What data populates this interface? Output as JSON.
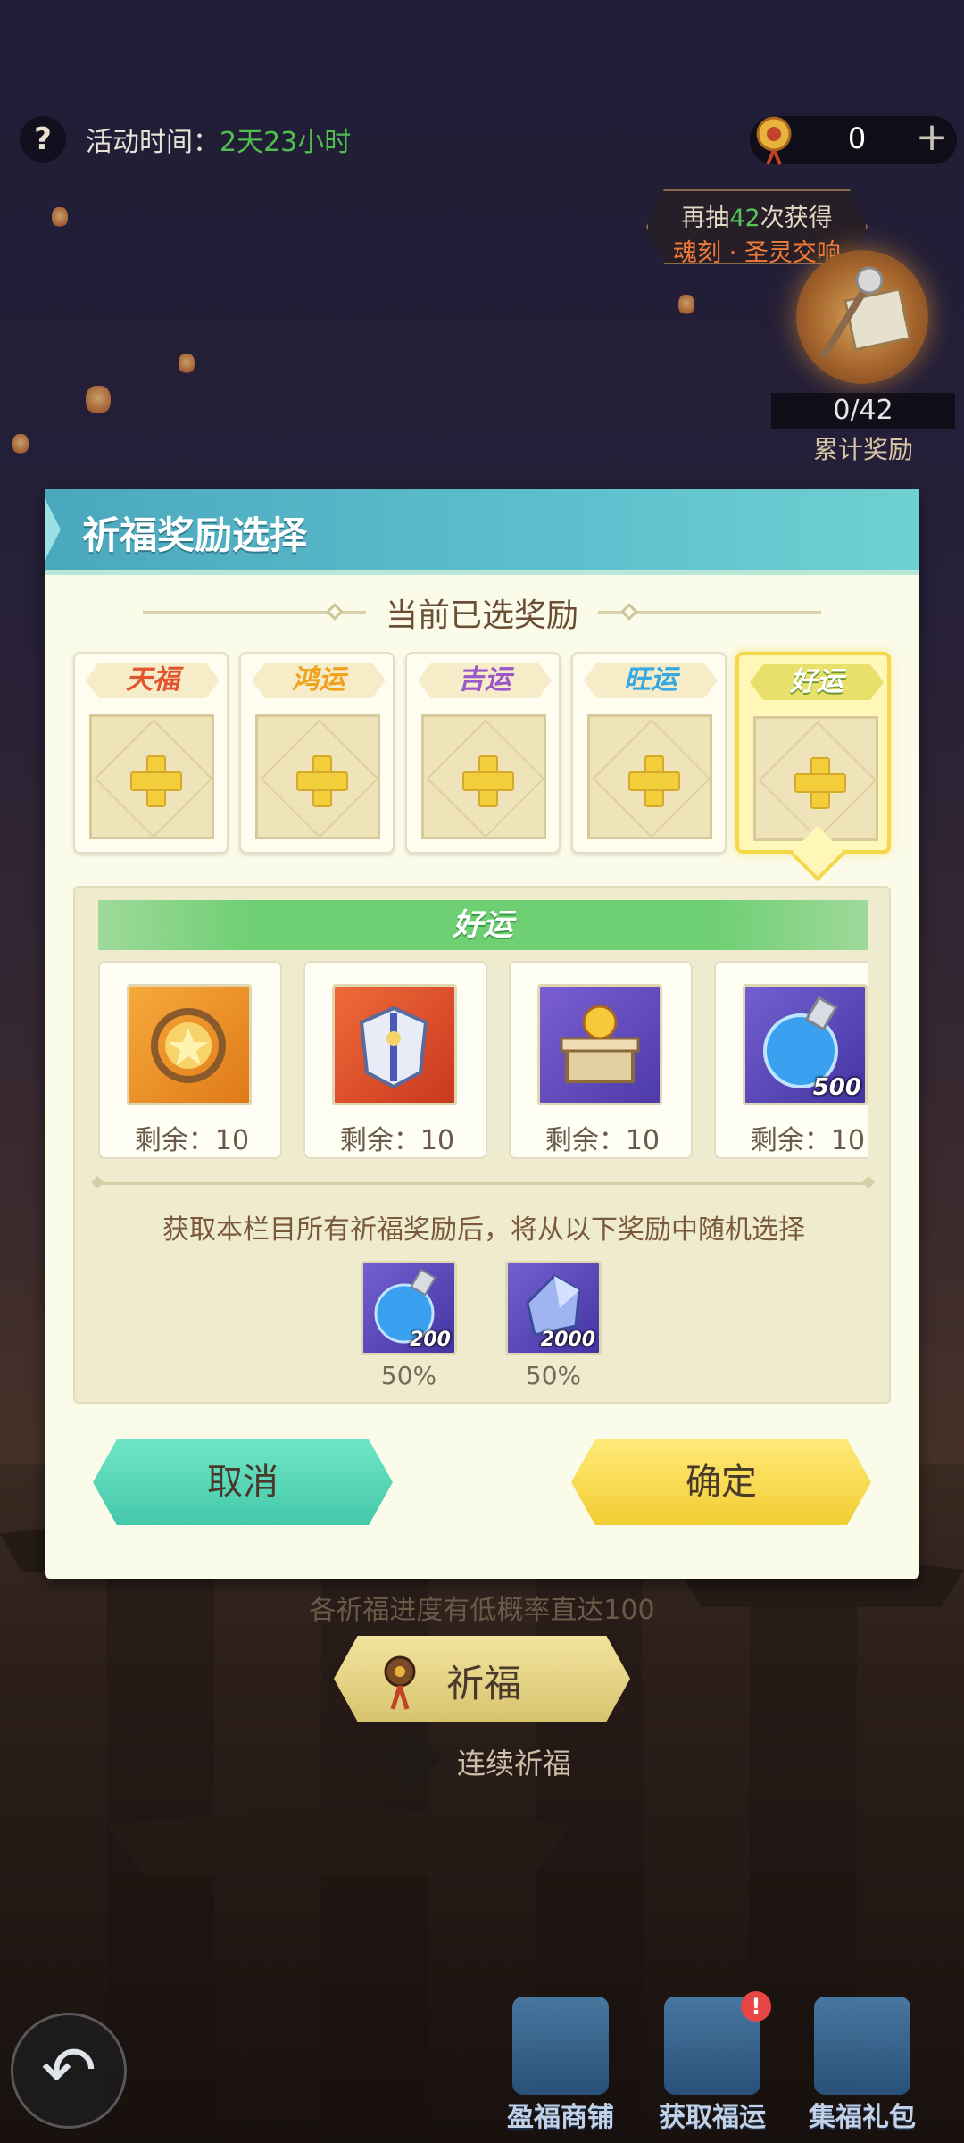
{
  "top_bar": {
    "event_time_label": "活动时间：",
    "event_time_value": "2天23小时",
    "currency_amount": "0",
    "add_symbol": "+"
  },
  "draw_hint": {
    "prefix": "再抽",
    "count": "42",
    "suffix": "次获得",
    "reward_name": "魂刻 · 圣灵交响"
  },
  "cumulative_reward": {
    "progress": "0/42",
    "label": "累计奖励"
  },
  "modal": {
    "title": "祈福奖励选择",
    "section_title": "当前已选奖励",
    "slots": [
      {
        "label": "天福",
        "color": "#e0552f"
      },
      {
        "label": "鸿运",
        "color": "#f0a21c"
      },
      {
        "label": "吉运",
        "color": "#9a58c8"
      },
      {
        "label": "旺运",
        "color": "#38a8e0"
      },
      {
        "label": "好运",
        "color": "#5ab54a",
        "active": true
      }
    ],
    "panel": {
      "title": "好运",
      "items": [
        {
          "remain": "剩余：10",
          "icon": "golden-compass-icon",
          "colors": [
            "#f6a93a",
            "#e07a18"
          ]
        },
        {
          "remain": "剩余：10",
          "icon": "armor-icon",
          "colors": [
            "#f06a3a",
            "#c8381e"
          ]
        },
        {
          "remain": "剩余：10",
          "icon": "treasure-orb-chest-icon",
          "colors": [
            "#7a5fd2",
            "#4e3aa8"
          ]
        },
        {
          "remain": "剩余：10",
          "icon": "blue-potion-icon",
          "qty": "500",
          "colors": [
            "#7360d0",
            "#4434a2"
          ]
        }
      ],
      "random_note": "获取本栏目所有祈福奖励后，将从以下奖励中随机选择",
      "random_items": [
        {
          "icon": "blue-potion-icon",
          "qty": "200",
          "pct": "50%"
        },
        {
          "icon": "crystal-shard-icon",
          "qty": "2000",
          "pct": "50%"
        }
      ]
    },
    "cancel_label": "取消",
    "confirm_label": "确定"
  },
  "footer": {
    "probability_note": "各祈福进度有低概率直达100",
    "pray_label": "祈福",
    "continuous_label": "连续祈福"
  },
  "bottom_nav": [
    {
      "label": "盈福商铺",
      "icon": "shop-chest-icon"
    },
    {
      "label": "获取福运",
      "icon": "scroll-book-icon",
      "badge": "!"
    },
    {
      "label": "集福礼包",
      "icon": "gift-box-icon"
    }
  ]
}
